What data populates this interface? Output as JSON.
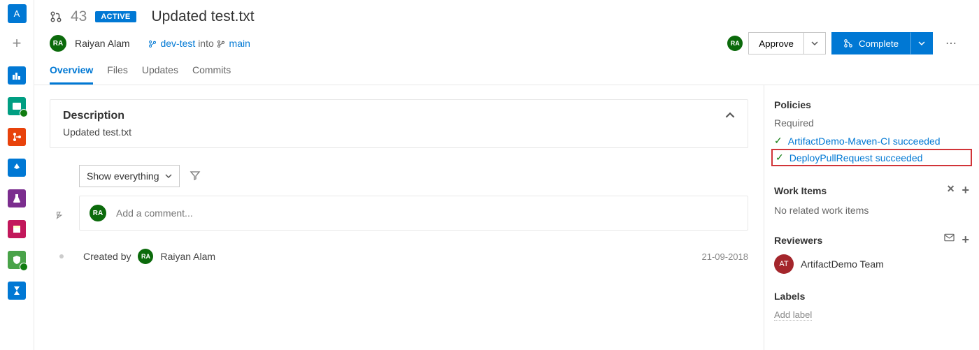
{
  "sidebar": {
    "logo_letter": "A"
  },
  "pr": {
    "number": "43",
    "status": "ACTIVE",
    "title": "Updated test.txt",
    "author_initials": "RA",
    "author_name": "Raiyan Alam",
    "source_branch": "dev-test",
    "into_label": "into",
    "target_branch": "main"
  },
  "actions": {
    "approve": "Approve",
    "complete": "Complete"
  },
  "tabs": {
    "overview": "Overview",
    "files": "Files",
    "updates": "Updates",
    "commits": "Commits"
  },
  "description": {
    "heading": "Description",
    "body": "Updated test.txt"
  },
  "filter": {
    "show_label": "Show everything"
  },
  "comment": {
    "placeholder": "Add a comment...",
    "avatar_initials": "RA"
  },
  "timeline": {
    "created_by_label": "Created by",
    "creator": "Raiyan Alam",
    "creator_initials": "RA",
    "date": "21-09-2018"
  },
  "right": {
    "policies_heading": "Policies",
    "required_label": "Required",
    "policies": [
      {
        "text": "ArtifactDemo-Maven-CI succeeded",
        "highlighted": false
      },
      {
        "text": "DeployPullRequest succeeded",
        "highlighted": true
      }
    ],
    "work_items_heading": "Work Items",
    "work_items_empty": "No related work items",
    "reviewers_heading": "Reviewers",
    "reviewer": {
      "initials": "AT",
      "name": "ArtifactDemo Team"
    },
    "labels_heading": "Labels",
    "add_label": "Add label",
    "viewer_initials": "RA"
  }
}
